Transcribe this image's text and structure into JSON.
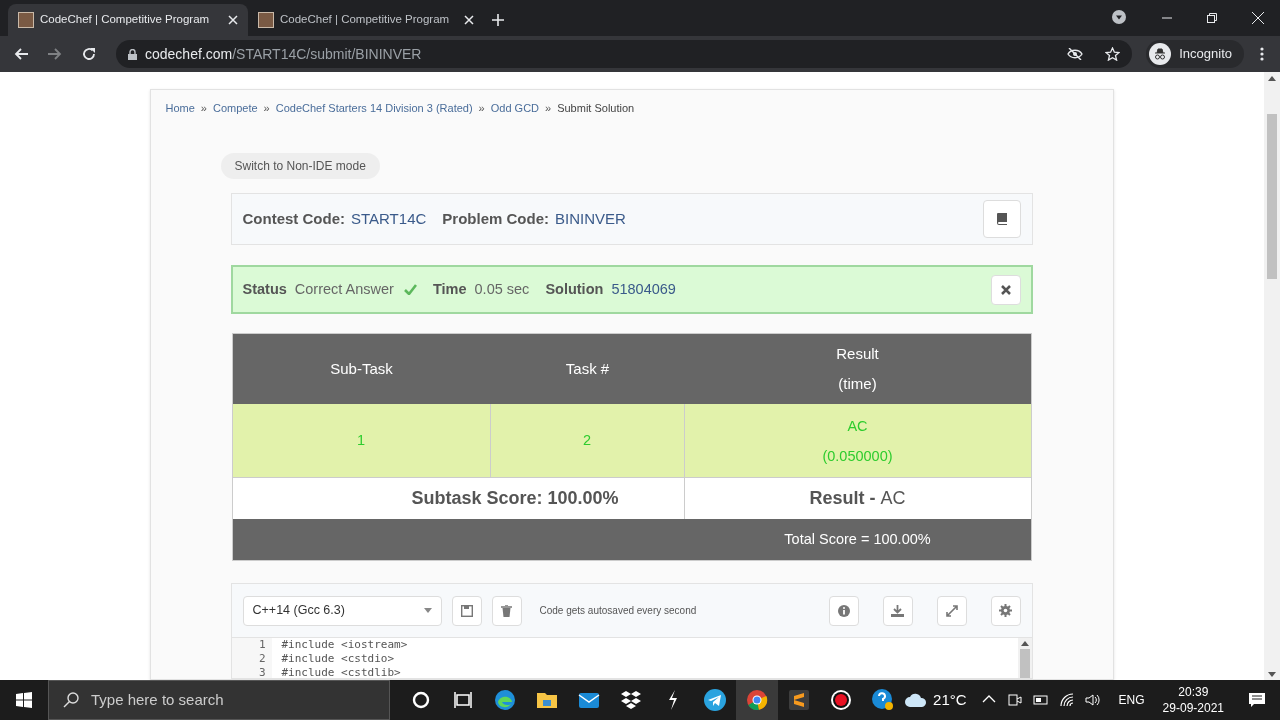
{
  "browser": {
    "tabs": [
      {
        "title": "CodeChef | Competitive Program",
        "selected": true
      },
      {
        "title": "CodeChef | Competitive Program",
        "selected": false
      }
    ],
    "url": {
      "domain": "codechef.com",
      "path": "/START14C/submit/BININVER"
    },
    "profile": "Incognito"
  },
  "breadcrumb": [
    {
      "label": "Home",
      "sep": "»",
      "link": true
    },
    {
      "label": "Compete",
      "sep": "»",
      "link": true
    },
    {
      "label": "CodeChef Starters 14 Division 3 (Rated)",
      "sep": "»",
      "link": true
    },
    {
      "label": "Odd GCD",
      "sep": "»",
      "link": true
    },
    {
      "label": "Submit Solution",
      "link": false
    }
  ],
  "mode_button": "Switch to Non-IDE mode",
  "codes": [
    {
      "label": "Contest Code:",
      "value": "START14C"
    },
    {
      "label": "Problem Code:",
      "value": "BININVER"
    }
  ],
  "status": [
    {
      "label": "Status",
      "value": "Correct Answer",
      "check": true,
      "link": false
    },
    {
      "label": "Time",
      "value": "0.05 sec",
      "check": false,
      "link": false
    },
    {
      "label": "Solution",
      "value": "51804069",
      "check": false,
      "link": true
    }
  ],
  "table": {
    "columns": [
      [
        "Sub-Task"
      ],
      [
        "Task #"
      ],
      [
        "Result",
        "(time)"
      ]
    ],
    "rows": [
      {
        "subtask": "1",
        "task": "2",
        "result": "AC",
        "time": "(0.050000)"
      }
    ],
    "subtask_score": "Subtask Score: 100.00%",
    "result_label": "Result -",
    "result_value": "AC",
    "total": "Total Score = 100.00%"
  },
  "editor": {
    "language": "C++14 (Gcc 6.3)",
    "note": "Code gets autosaved every second",
    "lines": [
      {
        "num": "1",
        "code": "#include <iostream>"
      },
      {
        "num": "2",
        "code": "#include <cstdio>"
      },
      {
        "num": "3",
        "code": "#include <cstdlib>"
      }
    ]
  },
  "taskbar": {
    "search": "Type here to search",
    "weather": "21°C",
    "language": "ENG",
    "time": "20:39",
    "date": "29-09-2021"
  }
}
